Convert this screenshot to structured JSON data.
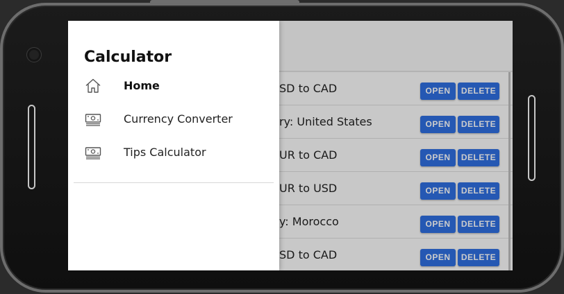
{
  "drawer": {
    "title": "Calculator",
    "items": [
      {
        "label": "Home",
        "icon": "home-icon",
        "active": true
      },
      {
        "label": "Currency Converter",
        "icon": "cash-icon",
        "active": false
      },
      {
        "label": "Tips Calculator",
        "icon": "cash-icon",
        "active": false
      }
    ]
  },
  "list": {
    "rows": [
      {
        "text": "SD to CAD",
        "open_label": "OPEN",
        "delete_label": "DELETE"
      },
      {
        "text": "ry: United States",
        "open_label": "OPEN",
        "delete_label": "DELETE"
      },
      {
        "text": "UR to CAD",
        "open_label": "OPEN",
        "delete_label": "DELETE"
      },
      {
        "text": "UR to USD",
        "open_label": "OPEN",
        "delete_label": "DELETE"
      },
      {
        "text": "y: Morocco",
        "open_label": "OPEN",
        "delete_label": "DELETE"
      },
      {
        "text": "SD to CAD",
        "open_label": "OPEN",
        "delete_label": "DELETE"
      }
    ]
  },
  "colors": {
    "button_blue": "#2f6fe0",
    "overlay": "rgba(0,0,0,0.2)"
  }
}
